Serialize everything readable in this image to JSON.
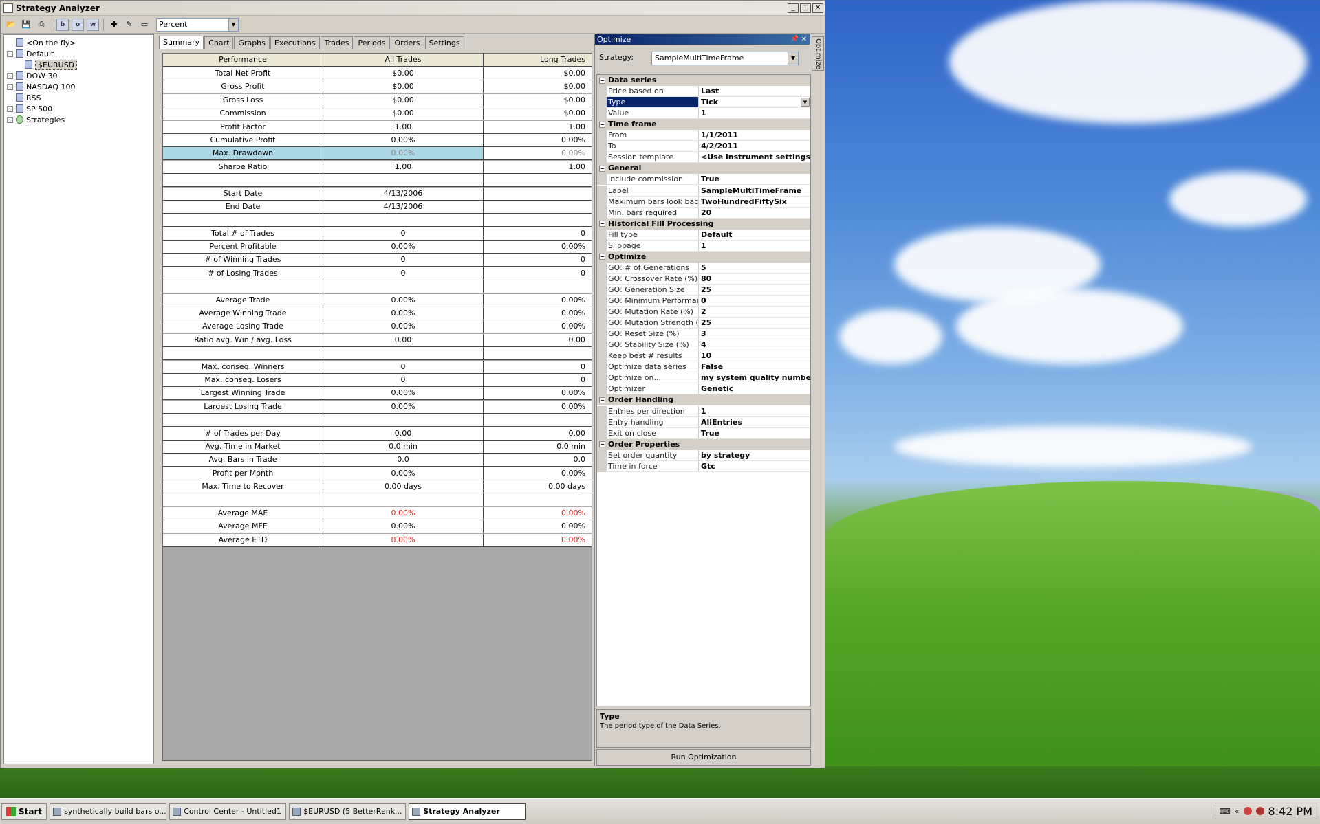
{
  "window": {
    "title": "Strategy Analyzer"
  },
  "toolbar": {
    "display_value": "Percent",
    "sq_buttons": [
      "b",
      "o",
      "w"
    ]
  },
  "tree": [
    {
      "label": "<On the fly>",
      "expand": "",
      "indent": 1
    },
    {
      "label": "Default",
      "expand": "−",
      "indent": 0
    },
    {
      "label": "$EURUSD",
      "expand": "",
      "indent": 2,
      "selected": true
    },
    {
      "label": "DOW 30",
      "expand": "+",
      "indent": 0
    },
    {
      "label": "NASDAQ 100",
      "expand": "+",
      "indent": 0
    },
    {
      "label": "RSS",
      "expand": "",
      "indent": 1
    },
    {
      "label": "SP 500",
      "expand": "+",
      "indent": 0
    },
    {
      "label": "Strategies",
      "expand": "+",
      "indent": 0,
      "star": true
    }
  ],
  "tabs": [
    "Summary",
    "Chart",
    "Graphs",
    "Executions",
    "Trades",
    "Periods",
    "Orders",
    "Settings"
  ],
  "grid": {
    "headers": [
      "Performance",
      "All Trades",
      "Long Trades"
    ],
    "rows": [
      [
        "Total Net Profit",
        "$0.00",
        "$0.00",
        ""
      ],
      [
        "Gross Profit",
        "$0.00",
        "$0.00",
        ""
      ],
      [
        "Gross Loss",
        "$0.00",
        "$0.00",
        ""
      ],
      [
        "Commission",
        "$0.00",
        "$0.00",
        ""
      ],
      [
        "Profit Factor",
        "1.00",
        "1.00",
        ""
      ],
      [
        "Cumulative Profit",
        "0.00%",
        "0.00%",
        ""
      ],
      [
        "Max. Drawdown",
        "0.00%",
        "0.00%",
        "hl"
      ],
      [
        "Sharpe Ratio",
        "1.00",
        "1.00",
        ""
      ],
      [
        "",
        "",
        "",
        ""
      ],
      [
        "Start Date",
        "4/13/2006",
        "",
        ""
      ],
      [
        "End Date",
        "4/13/2006",
        "",
        ""
      ],
      [
        "",
        "",
        "",
        ""
      ],
      [
        "Total # of Trades",
        "0",
        "0",
        ""
      ],
      [
        "Percent Profitable",
        "0.00%",
        "0.00%",
        ""
      ],
      [
        "# of Winning Trades",
        "0",
        "0",
        ""
      ],
      [
        "# of Losing Trades",
        "0",
        "0",
        ""
      ],
      [
        "",
        "",
        "",
        ""
      ],
      [
        "Average Trade",
        "0.00%",
        "0.00%",
        ""
      ],
      [
        "Average Winning Trade",
        "0.00%",
        "0.00%",
        ""
      ],
      [
        "Average Losing Trade",
        "0.00%",
        "0.00%",
        ""
      ],
      [
        "Ratio avg. Win / avg. Loss",
        "0.00",
        "0.00",
        ""
      ],
      [
        "",
        "",
        "",
        ""
      ],
      [
        "Max. conseq. Winners",
        "0",
        "0",
        ""
      ],
      [
        "Max. conseq. Losers",
        "0",
        "0",
        ""
      ],
      [
        "Largest Winning Trade",
        "0.00%",
        "0.00%",
        ""
      ],
      [
        "Largest Losing Trade",
        "0.00%",
        "0.00%",
        ""
      ],
      [
        "",
        "",
        "",
        ""
      ],
      [
        "# of Trades per Day",
        "0.00",
        "0.00",
        ""
      ],
      [
        "Avg. Time in Market",
        "0.0 min",
        "0.0 min",
        ""
      ],
      [
        "Avg. Bars in Trade",
        "0.0",
        "0.0",
        ""
      ],
      [
        "Profit per Month",
        "0.00%",
        "0.00%",
        ""
      ],
      [
        "Max. Time to Recover",
        "0.00 days",
        "0.00 days",
        ""
      ],
      [
        "",
        "",
        "",
        ""
      ],
      [
        "Average MAE",
        "0.00%",
        "0.00%",
        "red"
      ],
      [
        "Average MFE",
        "0.00%",
        "0.00%",
        ""
      ],
      [
        "Average ETD",
        "0.00%",
        "0.00%",
        "red"
      ]
    ]
  },
  "optimize": {
    "title": "Optimize",
    "side_tab": "Optimize",
    "strategy_label": "Strategy:",
    "strategy_value": "SampleMultiTimeFrame",
    "grid": [
      {
        "cat": "Data series"
      },
      {
        "k": "Price based on",
        "v": "Last"
      },
      {
        "k": "Type",
        "v": "Tick",
        "sel": true
      },
      {
        "k": "Value",
        "v": "1"
      },
      {
        "cat": "Time frame"
      },
      {
        "k": "From",
        "v": "1/1/2011"
      },
      {
        "k": "To",
        "v": "4/2/2011"
      },
      {
        "k": "Session template",
        "v": "<Use instrument settings>"
      },
      {
        "cat": "General"
      },
      {
        "k": "Include commission",
        "v": "True"
      },
      {
        "k": "Label",
        "v": "SampleMultiTimeFrame"
      },
      {
        "k": "Maximum bars look back",
        "v": "TwoHundredFiftySix"
      },
      {
        "k": "Min. bars required",
        "v": "20"
      },
      {
        "cat": "Historical Fill Processing"
      },
      {
        "k": "Fill type",
        "v": "Default"
      },
      {
        "k": "Slippage",
        "v": "1"
      },
      {
        "cat": "Optimize"
      },
      {
        "k": "GO: # of Generations",
        "v": "5"
      },
      {
        "k": "GO: Crossover Rate (%)",
        "v": "80"
      },
      {
        "k": "GO: Generation Size",
        "v": "25"
      },
      {
        "k": "GO: Minimum Performance",
        "v": "0"
      },
      {
        "k": "GO: Mutation Rate (%)",
        "v": "2"
      },
      {
        "k": "GO: Mutation Strength (%)",
        "v": "25"
      },
      {
        "k": "GO: Reset Size (%)",
        "v": "3"
      },
      {
        "k": "GO: Stability Size (%)",
        "v": "4"
      },
      {
        "k": "Keep best # results",
        "v": "10"
      },
      {
        "k": "Optimize data series",
        "v": "False"
      },
      {
        "k": "Optimize on...",
        "v": "my system quality number"
      },
      {
        "k": "Optimizer",
        "v": "Genetic"
      },
      {
        "cat": "Order Handling"
      },
      {
        "k": "Entries per direction",
        "v": "1"
      },
      {
        "k": "Entry handling",
        "v": "AllEntries"
      },
      {
        "k": "Exit on close",
        "v": "True"
      },
      {
        "cat": "Order Properties"
      },
      {
        "k": "Set order quantity",
        "v": "by strategy"
      },
      {
        "k": "Time in force",
        "v": "Gtc"
      }
    ],
    "desc_title": "Type",
    "desc_text": "The period type of the Data Series.",
    "run_button": "Run Optimization"
  },
  "taskbar": {
    "start": "Start",
    "tasks": [
      {
        "label": "synthetically build bars o...",
        "active": false
      },
      {
        "label": "Control Center - Untitled1",
        "active": false
      },
      {
        "label": "$EURUSD (5 BetterRenk...",
        "active": false
      },
      {
        "label": "Strategy Analyzer",
        "active": true
      }
    ],
    "clock": "8:42 PM"
  }
}
